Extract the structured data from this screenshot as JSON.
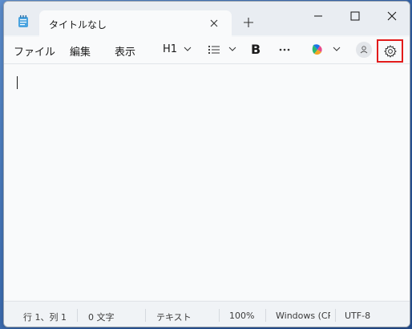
{
  "window": {
    "tab_title": "タイトルなし",
    "new_tab": "+"
  },
  "menu": {
    "file": "ファイル",
    "edit": "編集",
    "view": "表示"
  },
  "toolbar": {
    "heading": "H1",
    "list_icon": "list-icon",
    "bold": "B",
    "more": "···",
    "copilot_icon": "copilot-icon",
    "profile_icon": "profile-icon",
    "settings_icon": "gear-icon"
  },
  "status": {
    "position": "行 1、列 1",
    "chars": "0 文字",
    "mode": "テキスト",
    "zoom": "100%",
    "eol": "Windows (CRLF)",
    "encoding": "UTF-8"
  },
  "colors": {
    "highlight": "#e21b1b",
    "accent": "#1a73e8"
  }
}
